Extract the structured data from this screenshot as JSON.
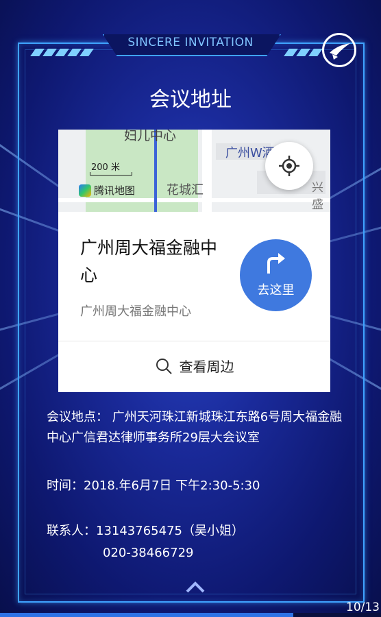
{
  "header": {
    "tag": "SINCERE INVITATION",
    "title": "会议地址"
  },
  "map": {
    "label_top": "妇儿中心",
    "label_right": "广州W酒",
    "label_park": "花城汇",
    "label_edge": "兴盛",
    "scale": "200 米",
    "provider": "腾讯地图"
  },
  "place": {
    "name": "广州周大福金融中心",
    "subtitle": "广州周大福金融中心",
    "go_label": "去这里",
    "nearby_label": "查看周边"
  },
  "info": {
    "location": "会议地点： 广州天河珠江新城珠江东路6号周大福金融中心广信君达律师事务所29层大会议室",
    "time": "时间：2018.年6月7日   下午2:30-5:30",
    "contact": "联系人：13143765475（吴小姐）",
    "phone": "020-38466729"
  },
  "page": {
    "indicator": "10/13",
    "progress": 0.77
  },
  "icons": [
    "logo-icon",
    "locate-icon",
    "turn-right-icon",
    "search-icon",
    "chevron-up-icon"
  ]
}
